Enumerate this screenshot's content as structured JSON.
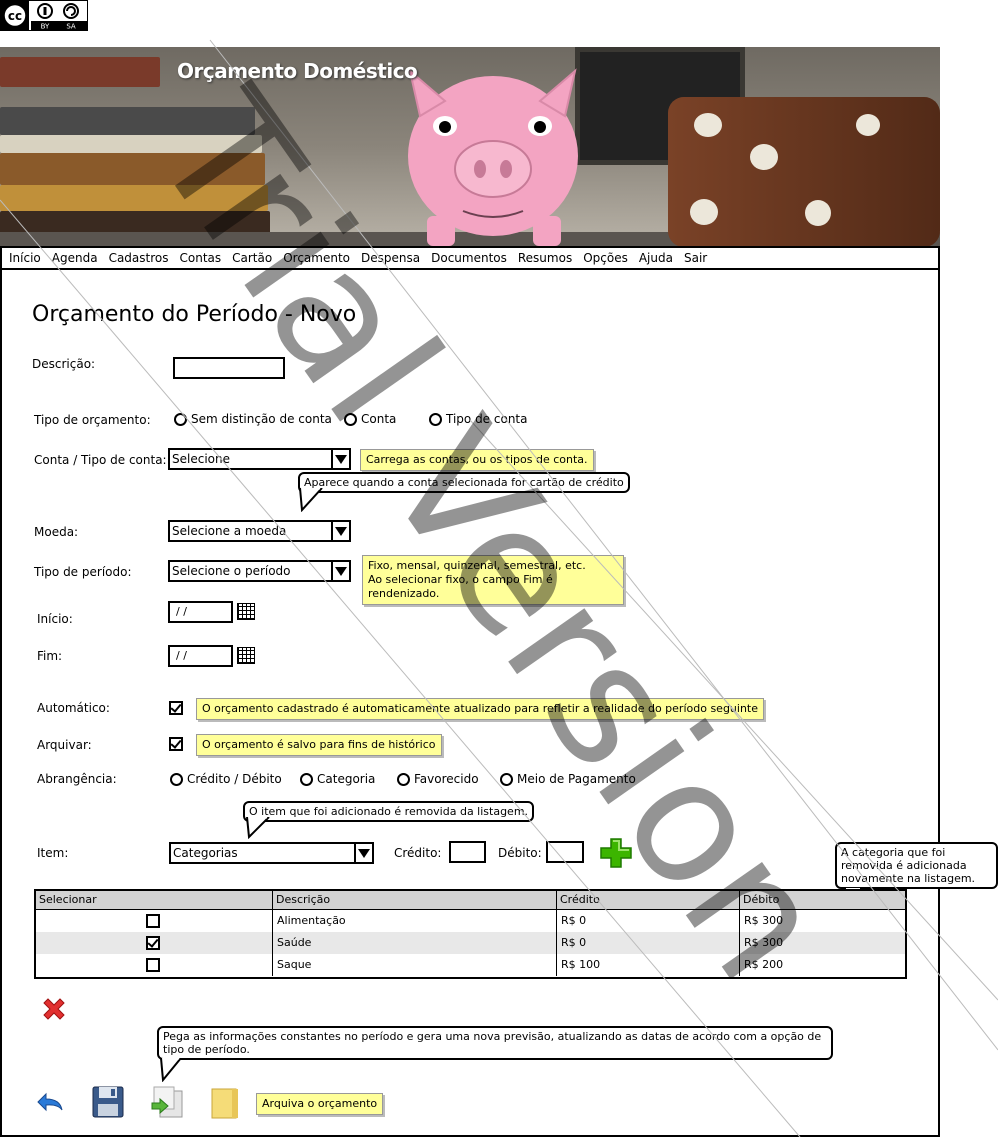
{
  "license": {
    "icon": "cc-by-sa-icon",
    "by": "BY",
    "sa": "SA"
  },
  "header": {
    "title": "Orçamento Doméstico"
  },
  "menu": [
    "Início",
    "Agenda",
    "Cadastros",
    "Contas",
    "Cartão",
    "Orçamento",
    "Despensa",
    "Documentos",
    "Resumos",
    "Opções",
    "Ajuda",
    "Sair"
  ],
  "page": {
    "title": "Orçamento do Período - Novo"
  },
  "form": {
    "descricao_label": "Descrição:",
    "descricao_value": "",
    "tipo_orcamento_label": "Tipo de orçamento:",
    "tipo_orcamento_options": [
      "Sem distinção de conta",
      "Conta",
      "Tipo de conta"
    ],
    "conta_label": "Conta / Tipo de conta:",
    "conta_value": "Selecione",
    "moeda_label": "Moeda:",
    "moeda_value": "Selecione a moeda",
    "periodo_label": "Tipo de período:",
    "periodo_value": "Selecione o período",
    "inicio_label": "Início:",
    "inicio_value": " /  /",
    "fim_label": "Fim:",
    "fim_value": " /  /",
    "automatico_label": "Automático:",
    "automatico_checked": true,
    "arquivar_label": "Arquivar:",
    "arquivar_checked": true,
    "abrangencia_label": "Abrangência:",
    "abrangencia_options": [
      "Crédito / Débito",
      "Categoria",
      "Favorecido",
      "Meio de Pagamento"
    ],
    "item_label": "Item:",
    "item_value": "Categorias",
    "credito_label": "Crédito:",
    "debito_label": "Débito:"
  },
  "notes": {
    "conta_note": "Carrega as contas, ou os tipos de conta.",
    "conta_bubble": "Aparece quando a conta selecionada for cartão de crédito",
    "periodo_note_1": "Fixo, mensal, quinzenal, semestral, etc.",
    "periodo_note_2": "Ao selecionar fixo, o campo Fim é rendenizado.",
    "automatico_note": "O orçamento cadastrado é automaticamente atualizado para refletir a realidade do período seguinte",
    "arquivar_note": "O orçamento é salvo para fins de histórico",
    "item_bubble": "O item que foi adicionado é removida da listagem.",
    "categoria_bubble": "A categoria que foi removida é adicionada novamente na listagem.",
    "previsao_bubble": "Pega as informações constantes no período e gera uma nova previsão, atualizando as datas de acordo com a opção de tipo de período.",
    "arquivar_orcamento_note": "Arquiva o orçamento"
  },
  "table": {
    "headers": [
      "Selecionar",
      "Descrição",
      "Crédito",
      "Débito"
    ],
    "rows": [
      {
        "selected": false,
        "descricao": "Alimentação",
        "credito": "R$ 0",
        "debito": "R$ 300"
      },
      {
        "selected": true,
        "descricao": "Saúde",
        "credito": "R$ 0",
        "debito": "R$ 300"
      },
      {
        "selected": false,
        "descricao": "Saque",
        "credito": "R$ 100",
        "debito": "R$ 200"
      }
    ]
  },
  "watermark": "Trial Version",
  "icons": {
    "add": "add-icon",
    "remove": "remove-icon",
    "undo": "undo-icon",
    "save": "save-icon",
    "generate": "generate-forecast-icon",
    "archive": "archive-folder-icon",
    "calendar": "calendar-icon"
  },
  "colors": {
    "note": "#ffff99",
    "add": "#3cb500",
    "remove": "#e23030",
    "table_header": "#d2d2d2",
    "row_alt": "#e8e8e8"
  }
}
